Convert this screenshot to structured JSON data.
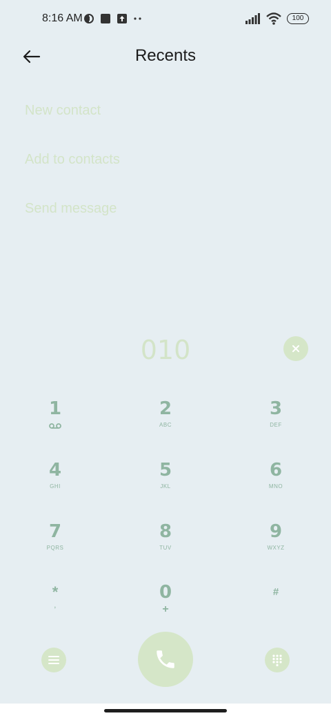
{
  "status_bar": {
    "time": "8:16 AM",
    "battery": "100",
    "icons": [
      "vpn-icon",
      "square-notification-icon",
      "upload-icon",
      "more-dots-icon",
      "signal-icon",
      "wifi-icon",
      "battery-icon"
    ]
  },
  "header": {
    "title": "Recents",
    "back_icon": "back-arrow-icon"
  },
  "menu": {
    "items": [
      {
        "label": "New contact"
      },
      {
        "label": "Add to contacts"
      },
      {
        "label": "Send message"
      }
    ]
  },
  "dialer": {
    "number": "010",
    "keys": [
      {
        "digit": "1",
        "letters": ""
      },
      {
        "digit": "2",
        "letters": "ABC"
      },
      {
        "digit": "3",
        "letters": "DEF"
      },
      {
        "digit": "4",
        "letters": "GHI"
      },
      {
        "digit": "5",
        "letters": "JKL"
      },
      {
        "digit": "6",
        "letters": "MNO"
      },
      {
        "digit": "7",
        "letters": "PQRS"
      },
      {
        "digit": "8",
        "letters": "TUV"
      },
      {
        "digit": "9",
        "letters": "WXYZ"
      },
      {
        "digit": "*",
        "letters": ","
      },
      {
        "digit": "0",
        "letters": "+"
      },
      {
        "digit": "#",
        "letters": ""
      }
    ]
  },
  "colors": {
    "background": "#e6eef2",
    "accent_light": "#d5e6c8",
    "key_text": "#8fb5a1",
    "faded_text": "#d3e4c8"
  }
}
